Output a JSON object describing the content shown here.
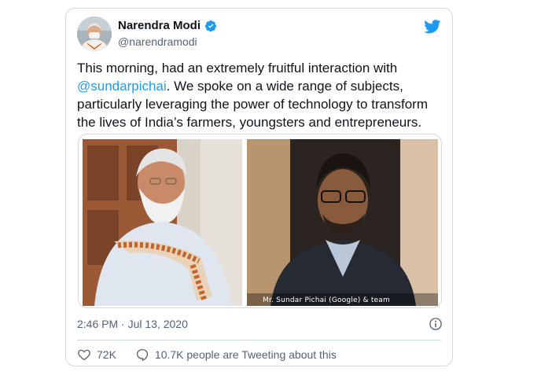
{
  "tweet": {
    "author_name": "Narendra Modi",
    "author_handle": "@narendramodi",
    "text_before": "This morning, had an extremely fruitful interaction with ",
    "mention": "@sundarpichai",
    "text_after": ". We spoke on a wide range of subjects, particularly leveraging the power of technology to transform the lives of India’s farmers, youngsters and entrepreneurs.",
    "timestamp": "2:46 PM · Jul 13, 2020",
    "like_count": "72K",
    "conversation_text": "10.7K people are Tweeting about this",
    "media_caption": "Mr. Sundar Pichai (Google) & team"
  },
  "icons": {
    "verified": "verified-badge-icon",
    "bird": "twitter-bird-icon",
    "info": "info-icon",
    "like": "heart-icon",
    "reply": "speech-bubble-icon"
  },
  "colors": {
    "accent": "#1d9bf0",
    "text": "#0f1419",
    "secondary": "#536471",
    "border": "#cfd9de"
  }
}
